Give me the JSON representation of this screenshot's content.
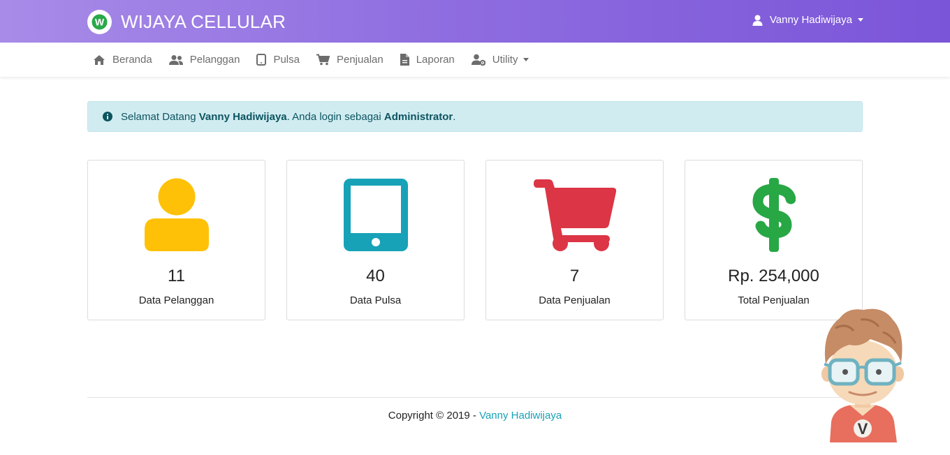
{
  "header": {
    "brand_title": "WIJAYA CELLULAR",
    "logo_letter": "W",
    "user_name": "Vanny Hadiwijaya"
  },
  "nav": {
    "items": [
      {
        "label": "Beranda",
        "icon": "home-icon"
      },
      {
        "label": "Pelanggan",
        "icon": "users-icon"
      },
      {
        "label": "Pulsa",
        "icon": "tablet-icon"
      },
      {
        "label": "Penjualan",
        "icon": "cart-icon"
      },
      {
        "label": "Laporan",
        "icon": "file-icon"
      },
      {
        "label": "Utility",
        "icon": "user-cog-icon"
      }
    ]
  },
  "alert": {
    "prefix": "Selamat Datang ",
    "name": "Vanny Hadiwijaya",
    "middle": ". Anda login sebagai ",
    "role": "Administrator",
    "suffix": "."
  },
  "cards": [
    {
      "value": "11",
      "label": "Data Pelanggan",
      "icon": "user-icon",
      "color": "#ffc107"
    },
    {
      "value": "40",
      "label": "Data Pulsa",
      "icon": "tablet-icon",
      "color": "#17a2b8"
    },
    {
      "value": "7",
      "label": "Data Penjualan",
      "icon": "cart-icon",
      "color": "#dc3545"
    },
    {
      "value": "Rp. 254,000",
      "label": "Total Penjualan",
      "icon": "dollar-icon",
      "color": "#28a745"
    }
  ],
  "footer": {
    "text": "Copyright © 2019 - ",
    "link": "Vanny Hadiwijaya",
    "mascot_letter": "V"
  },
  "colors": {
    "header_start": "#a88be8",
    "header_end": "#7b55d8",
    "alert_bg": "#d1ecf1",
    "link": "#17a2b8"
  }
}
